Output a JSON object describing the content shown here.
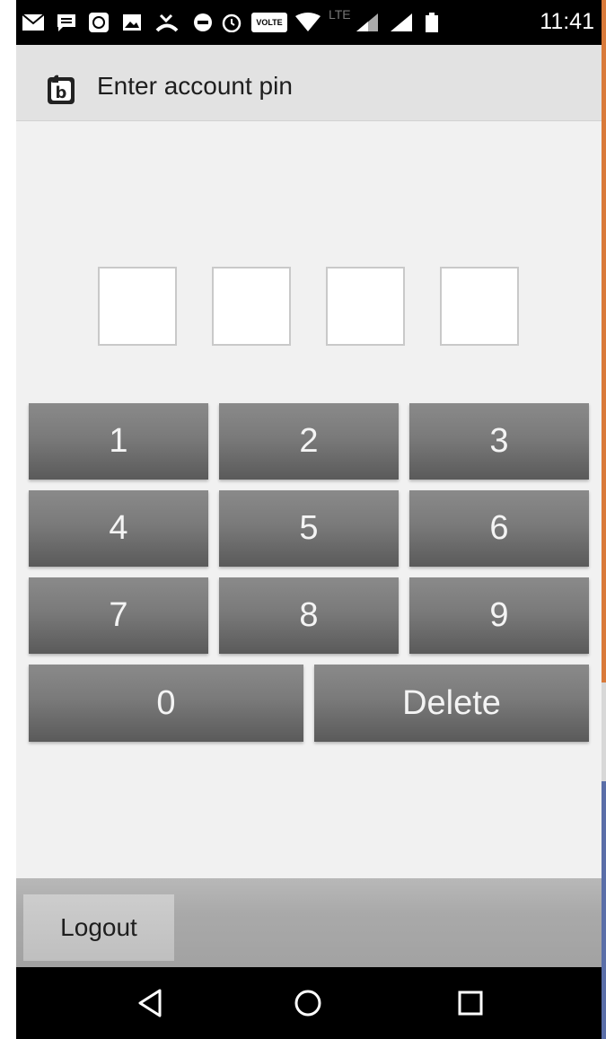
{
  "status_bar": {
    "time": "11:41",
    "icons": [
      "mail-icon",
      "message-icon",
      "sticker-icon",
      "image-icon",
      "missed-call-icon",
      "do-not-disturb-icon",
      "alarm-icon",
      "volte-icon",
      "wifi-icon",
      "lte-signal-icon",
      "signal-icon",
      "battery-icon"
    ],
    "volte_label": "VOLTE",
    "lte_label": "LTE"
  },
  "action_bar": {
    "title": "Enter account pin",
    "icon": "app-logo-icon"
  },
  "pin": {
    "digits": [
      "",
      "",
      "",
      ""
    ]
  },
  "keypad": {
    "keys": [
      "1",
      "2",
      "3",
      "4",
      "5",
      "6",
      "7",
      "8",
      "9"
    ],
    "zero": "0",
    "delete": "Delete"
  },
  "bottom": {
    "logout": "Logout"
  },
  "nav": {
    "icons": [
      "back-icon",
      "home-icon",
      "recents-icon"
    ]
  },
  "colors": {
    "key_gradient_top": "#8a8a8a",
    "key_gradient_bottom": "#5a5a5a",
    "background": "#f1f1f1",
    "status_bar": "#000000"
  }
}
